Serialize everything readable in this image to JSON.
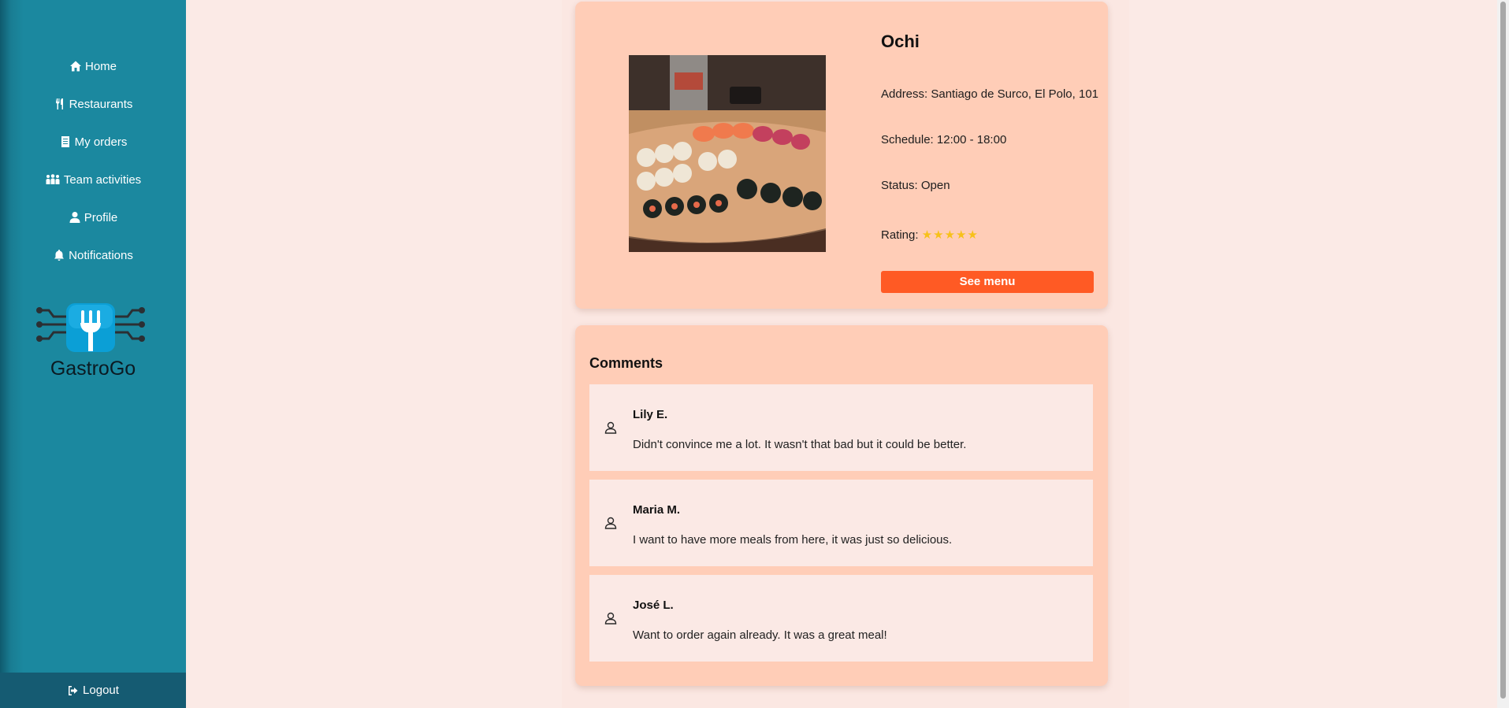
{
  "sidebar": {
    "nav": [
      {
        "label": "Home",
        "icon": "home-icon"
      },
      {
        "label": "Restaurants",
        "icon": "utensils-icon"
      },
      {
        "label": "My orders",
        "icon": "receipt-icon"
      },
      {
        "label": "Team activities",
        "icon": "people-group-icon"
      },
      {
        "label": "Profile",
        "icon": "user-icon"
      },
      {
        "label": "Notifications",
        "icon": "bell-icon"
      }
    ],
    "brand": "GastroGo",
    "logout_label": "Logout"
  },
  "restaurant": {
    "name": "Ochi",
    "address": "Address: Santiago de Surco, El Polo, 101",
    "schedule": "Schedule: 12:00 - 18:00",
    "status": "Status: Open",
    "rating_label": "Rating:",
    "rating_stars": "★★★★★",
    "rating_value": 5,
    "see_menu_label": "See menu"
  },
  "comments": {
    "title": "Comments",
    "items": [
      {
        "author": "Lily E.",
        "text": "Didn't convince me a lot. It wasn't that bad but it could be better."
      },
      {
        "author": "Maria M.",
        "text": "I want to have more meals from here, it was just so delicious."
      },
      {
        "author": "José L.",
        "text": "Want to order again already. It was a great meal!"
      }
    ]
  },
  "colors": {
    "sidebar": "#1b889f",
    "card": "#ffcdb7",
    "accent_button": "#ff5a24",
    "star": "#f7c11a",
    "background": "#fbeae6"
  }
}
